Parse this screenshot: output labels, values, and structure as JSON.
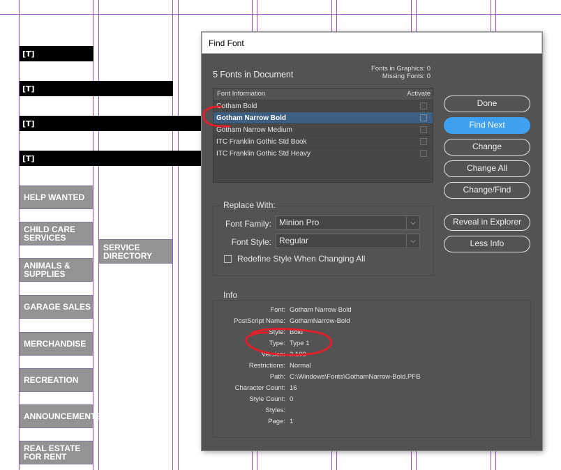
{
  "layout_markers": [
    "[T]",
    "[T]",
    "[T]",
    "[T]"
  ],
  "category_boxes": [
    "HELP WANTED",
    "CHILD CARE\nSERVICES",
    "ANIMALS &\nSUPPLIES",
    "GARAGE SALES",
    "MERCHANDISE",
    "RECREATION",
    "ANNOUNCEMENTS",
    "REAL ESTATE\nFOR RENT"
  ],
  "service_directory": "SERVICE\nDIRECTORY",
  "dialog": {
    "title": "Find Font",
    "fonts_count": "5 Fonts in Document",
    "fonts_in_graphics": "Fonts in Graphics: 0",
    "missing_fonts": "Missing Fonts: 0",
    "table": {
      "col_font_info": "Font Information",
      "col_activate": "Activate",
      "rows": [
        {
          "name": "Gotham Bold"
        },
        {
          "name": "Gotham Narrow Bold",
          "selected": true
        },
        {
          "name": "Gotham Narrow Medium"
        },
        {
          "name": "ITC Franklin Gothic Std Book"
        },
        {
          "name": "ITC Franklin Gothic Std Heavy"
        }
      ]
    },
    "buttons": {
      "done": "Done",
      "find_next": "Find Next",
      "change": "Change",
      "change_all": "Change All",
      "change_find": "Change/Find",
      "reveal": "Reveal in Explorer",
      "less_info": "Less Info"
    },
    "replace": {
      "title": "Replace With:",
      "font_family_label": "Font Family:",
      "font_family_value": "Minion Pro",
      "font_style_label": "Font Style:",
      "font_style_value": "Regular",
      "redefine_label": "Redefine Style When Changing All"
    },
    "info": {
      "title": "Info",
      "rows": [
        {
          "key": "Font:",
          "value": "Gotham Narrow Bold"
        },
        {
          "key": "PostScript Name:",
          "value": "GothamNarrow-Bold"
        },
        {
          "key": "Style:",
          "value": "Bold"
        },
        {
          "key": "Type:",
          "value": "Type 1"
        },
        {
          "key": "Version:",
          "value": "2.100"
        },
        {
          "key": "Restrictions:",
          "value": "Normal"
        },
        {
          "key": "Path:",
          "value": "C:\\Windows\\Fonts\\GothamNarrow-Bold.PFB"
        },
        {
          "key": "Character Count:",
          "value": "16"
        },
        {
          "key": "Style Count:",
          "value": "0"
        },
        {
          "key": "Styles:",
          "value": ""
        },
        {
          "key": "Page:",
          "value": "1"
        }
      ]
    }
  },
  "colors": {
    "dialog_bg": "#535353",
    "primary_button": "#3ea0ef",
    "selected_row": "#3e5f84",
    "guide": "#a050c8",
    "annotation": "#e0202a"
  }
}
